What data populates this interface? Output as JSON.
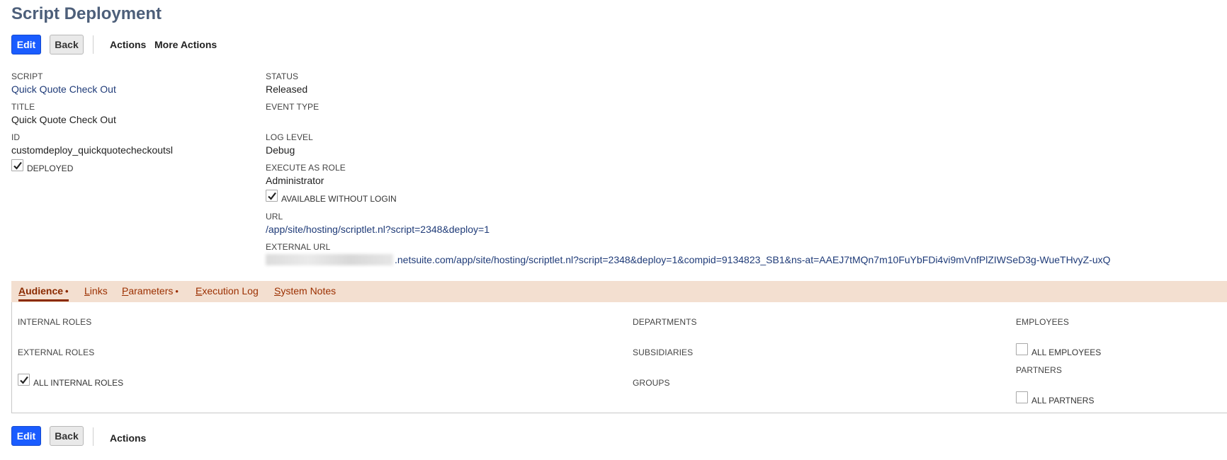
{
  "page": {
    "title": "Script Deployment"
  },
  "toolbar": {
    "edit_label": "Edit",
    "back_label": "Back",
    "actions_label": "Actions",
    "more_actions_label": "More Actions"
  },
  "fields": {
    "script": {
      "label": "SCRIPT",
      "value": "Quick Quote Check Out"
    },
    "title": {
      "label": "TITLE",
      "value": "Quick Quote Check Out"
    },
    "id": {
      "label": "ID",
      "value": "customdeploy_quickquotecheckoutsl"
    },
    "deployed": {
      "label": "DEPLOYED",
      "checked": true
    },
    "status": {
      "label": "STATUS",
      "value": "Released"
    },
    "event_type": {
      "label": "EVENT TYPE",
      "value": ""
    },
    "log_level": {
      "label": "LOG LEVEL",
      "value": "Debug"
    },
    "execute_as_role": {
      "label": "EXECUTE AS ROLE",
      "value": "Administrator"
    },
    "available_without_login": {
      "label": "AVAILABLE WITHOUT LOGIN",
      "checked": true
    },
    "url": {
      "label": "URL",
      "value": "/app/site/hosting/scriptlet.nl?script=2348&deploy=1"
    },
    "external_url": {
      "label": "EXTERNAL URL",
      "value": ".netsuite.com/app/site/hosting/scriptlet.nl?script=2348&deploy=1&compid=9134823_SB1&ns-at=AAEJ7tMQn7m10FuYbFDi4vi9mVnfPlZIWSeD3g-WueTHvyZ-uxQ"
    }
  },
  "tabs": [
    {
      "accel": "A",
      "rest": "udience",
      "dot": "•",
      "active": true
    },
    {
      "accel": "L",
      "rest": "inks",
      "dot": "",
      "active": false
    },
    {
      "accel": "P",
      "rest": "arameters",
      "dot": "•",
      "active": false
    },
    {
      "accel": "E",
      "rest": "xecution Log",
      "dot": "",
      "active": false
    },
    {
      "accel": "S",
      "rest": "ystem Notes",
      "dot": "",
      "active": false
    }
  ],
  "audience": {
    "internal_roles": "INTERNAL ROLES",
    "external_roles": "EXTERNAL ROLES",
    "all_internal_roles": {
      "label": "ALL INTERNAL ROLES",
      "checked": true
    },
    "departments": "DEPARTMENTS",
    "subsidiaries": "SUBSIDIARIES",
    "groups": "GROUPS",
    "employees": "EMPLOYEES",
    "all_employees": {
      "label": "ALL EMPLOYEES",
      "checked": false
    },
    "partners": "PARTNERS",
    "all_partners": {
      "label": "ALL PARTNERS",
      "checked": false
    }
  },
  "bottom_toolbar": {
    "edit_label": "Edit",
    "back_label": "Back",
    "actions_label": "Actions"
  }
}
